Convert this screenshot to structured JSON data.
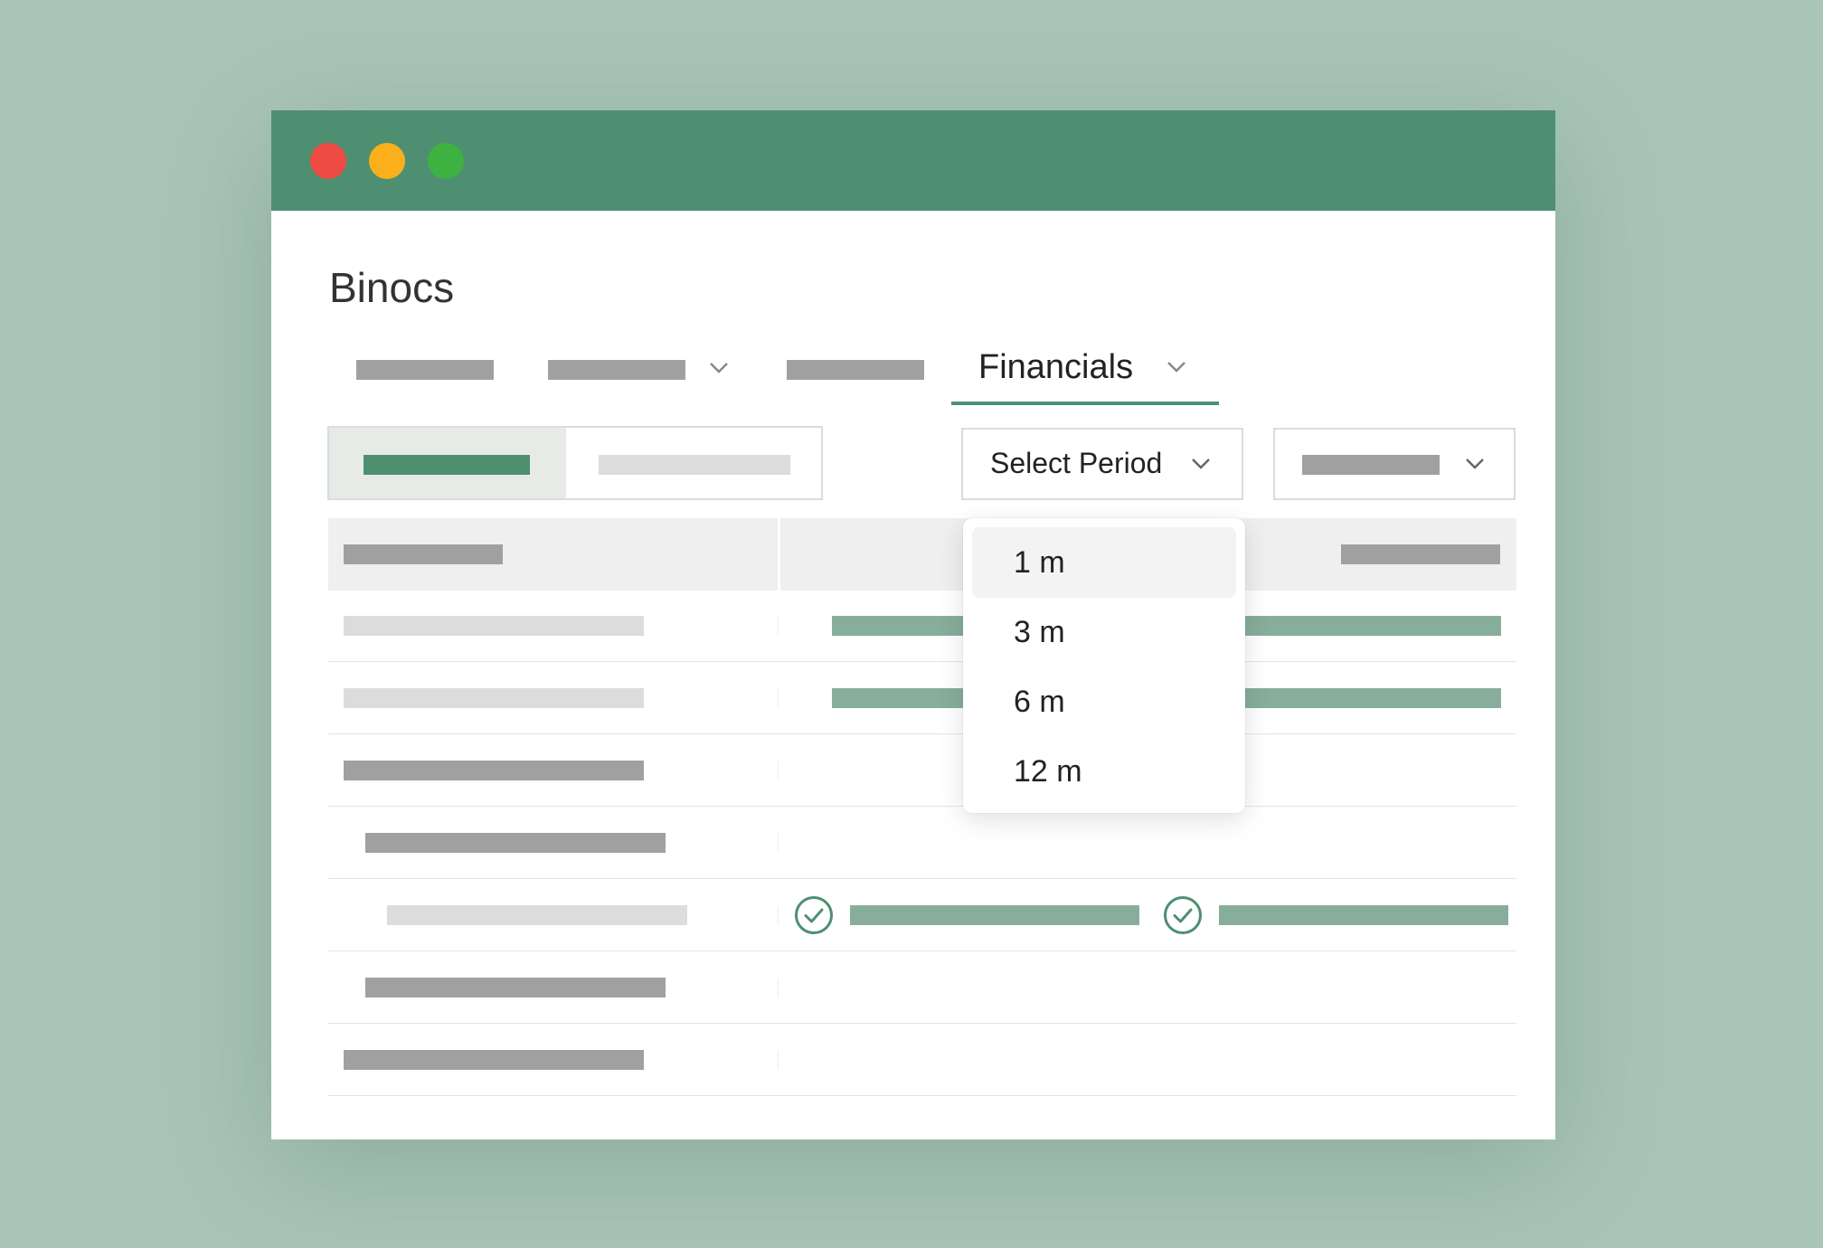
{
  "window": {
    "controls": [
      "close",
      "minimize",
      "maximize"
    ]
  },
  "app": {
    "title": "Binocs"
  },
  "nav": {
    "active_tab_label": "Financials"
  },
  "filters": {
    "period_select_label": "Select Period"
  },
  "period_dropdown": {
    "options": [
      "1 m",
      "3 m",
      "6 m",
      "12 m"
    ],
    "highlighted": "1 m"
  },
  "icons": {
    "chevron": "chevron-down-icon",
    "check": "check-circle-icon"
  },
  "colors": {
    "accent": "#4e8f72",
    "background": "#a9c5b8",
    "close": "#ef4b43",
    "minimize": "#fbaf1a",
    "maximize": "#3db240",
    "placeholder_dark": "#a0a0a0",
    "placeholder_light": "#dcdcdc",
    "placeholder_green": "#87ae9a"
  }
}
